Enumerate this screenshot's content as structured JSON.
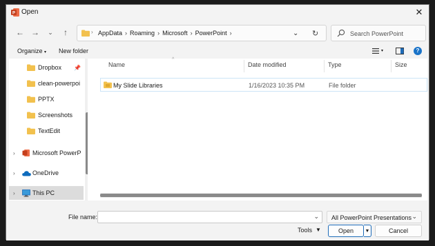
{
  "window": {
    "title": "Open",
    "close_symbol": "✕"
  },
  "nav": {
    "back": "←",
    "forward": "→",
    "recent": "⌄",
    "up": "↑"
  },
  "address": {
    "crumbs": [
      "AppData",
      "Roaming",
      "Microsoft",
      "PowerPoint"
    ],
    "separator": "›"
  },
  "search": {
    "placeholder": "Search PowerPoint"
  },
  "toolbar": {
    "organize": "Organize",
    "new_folder": "New folder",
    "help": "?"
  },
  "sidebar": {
    "items": [
      {
        "label": "Dropbox",
        "icon": "folder-icon",
        "pinned": true
      },
      {
        "label": "clean-powerpoi",
        "icon": "folder-icon"
      },
      {
        "label": "PPTX",
        "icon": "folder-icon"
      },
      {
        "label": "Screenshots",
        "icon": "folder-icon"
      },
      {
        "label": "TextEdit",
        "icon": "folder-icon"
      },
      {
        "label": "Microsoft PowerP",
        "icon": "powerpoint-icon",
        "expandable": true
      },
      {
        "label": "OneDrive",
        "icon": "onedrive-icon",
        "expandable": true
      },
      {
        "label": "This PC",
        "icon": "monitor-icon",
        "expandable": true,
        "selected": true
      }
    ]
  },
  "files": {
    "columns": [
      "Name",
      "Date modified",
      "Type",
      "Size"
    ],
    "rows": [
      {
        "name": "My Slide Libraries",
        "date": "1/16/2023 10:35 PM",
        "type": "File folder",
        "size": ""
      }
    ]
  },
  "footer": {
    "filename_label": "File name:",
    "filename_value": "",
    "filter": "All PowerPoint Presentations",
    "tools": "Tools",
    "open": "Open",
    "cancel": "Cancel"
  },
  "colors": {
    "accent": "#1d6bb8",
    "folder": "#f2c14e",
    "powerpoint": "#c43e1c",
    "onedrive": "#0f6cbd"
  }
}
